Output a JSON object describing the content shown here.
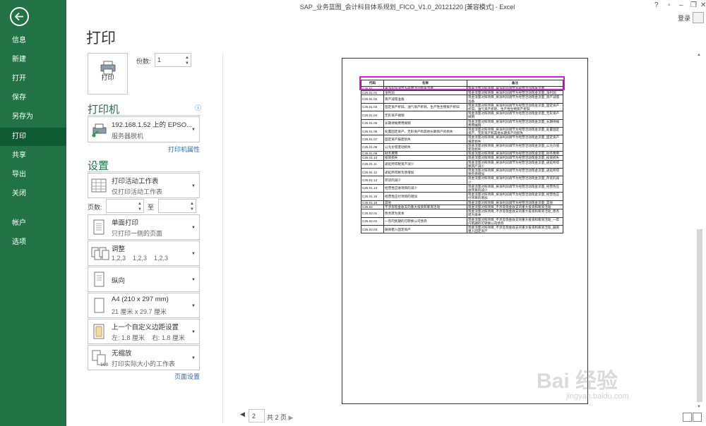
{
  "window": {
    "title": "SAP_业务蓝图_会计科目体系规划_FICO_V1.0_20121220  [兼容模式] - Excel",
    "help": "?",
    "login": "登录"
  },
  "nav": {
    "items": [
      "信息",
      "新建",
      "打开",
      "保存",
      "另存为",
      "打印",
      "共享",
      "导出",
      "关闭",
      "帐户",
      "选项"
    ],
    "active": "打印"
  },
  "print": {
    "heading": "打印",
    "print_button": "打印",
    "copies_label": "份数:",
    "copies_value": "1",
    "printer_section": "打印机",
    "printer_name": "192.168.1.52 上的 EPSO...",
    "printer_status": "服务器脱机",
    "printer_props": "打印机属性",
    "settings_section": "设置",
    "what_main": "打印活动工作表",
    "what_sub": "仅打印活动工作表",
    "pages_label": "页数:",
    "to_label": "至",
    "sides_main": "单面打印",
    "sides_sub": "只打印一侧的页面",
    "collate_main": "调整",
    "collate_sub": "1,2,3    1,2,3    1,2,3",
    "orientation": "纵向",
    "paper_main": "A4 (210 x 297 mm)",
    "paper_sub": "21 厘米 x 29.7 厘米",
    "margins_main": "上一个自定义边距设置",
    "margins_sub": "左: 1.8 厘米    右: 1.8 厘米",
    "scale_main": "无缩放",
    "scale_sub": "打印实际大小的工作表",
    "page_setup": "页面设置"
  },
  "preview": {
    "headers": [
      "代码",
      "名称",
      "备注"
    ],
    "rows": [
      [
        "C25.01",
        "将净利润调节为经营活动现金流量",
        "现金流量对照项目_将净利润调节为经营活动现金流量"
      ],
      [
        "C25.01.01",
        "净利润",
        "现金流量对照项目_将净利润调节为经营活动现金流量_净利润"
      ],
      [
        "C25.01.02",
        "资产减值准备",
        "现金流量对照项目_将净利润调节为经营活动现金流量_资产减值准备"
      ],
      [
        "C25.01.03",
        "固定资产折旧、油气资产折耗、生产性生物资产折旧",
        "现金流量对照项目_将净利润调节为经营活动现金流量_固定资产折旧、油气资产折耗、生产性生物资产折旧"
      ],
      [
        "C25.01.04",
        "无形资产摊销",
        "现金流量对照项目_将净利润调节为经营活动现金流量_无形资产摊销"
      ],
      [
        "C25.01.05",
        "长期待摊费用摊销",
        "现金流量对照项目_将净利润调节为经营活动现金流量_长期待摊费用摊销"
      ],
      [
        "C25.01.06",
        "处置固定资产、无形资产和其他长期资产的损失",
        "现金流量对照项目_将净利润调节为经营活动现金流量_处置固定资产、无形资产和其他长期资产的损失"
      ],
      [
        "C25.01.07",
        "固定资产报废损失",
        "现金流量对照项目_将净利润调节为经营活动现金流量_固定资产报废损失"
      ],
      [
        "C25.01.08",
        "公允价值变动损失",
        "现金流量对照项目_将净利润调节为经营活动现金流量_公允价值变动损失"
      ],
      [
        "C25.01.09",
        "财务费用",
        "现金流量对照项目_将净利润调节为经营活动现金流量_财务费用"
      ],
      [
        "C25.01.10",
        "投资损失",
        "现金流量对照项目_将净利润调节为经营活动现金流量_投资损失"
      ],
      [
        "C25.01.11",
        "递延所得税资产减少",
        "现金流量对照项目_将净利润调节为经营活动现金流量_递延所得税资产减少"
      ],
      [
        "C25.01.12",
        "递延所得税负债增加",
        "现金流量对照项目_将净利润调节为经营活动现金流量_递延所得税负债增加"
      ],
      [
        "C25.01.13",
        "存货的减少",
        "现金流量对照项目_将净利润调节为经营活动现金流量_存货的减少"
      ],
      [
        "C25.01.14",
        "经营性应收项目的减少",
        "现金流量对照项目_将净利润调节为经营活动现金流量_经营性应收项目的减少"
      ],
      [
        "C25.01.15",
        "经营性应付项目的增加",
        "现金流量对照项目_将净利润调节为经营活动现金流量_经营性应付项目的增加"
      ],
      [
        "C25.01.16",
        "其他",
        "现金流量对照项目_将净利润调节为经营活动现金流量_其他"
      ],
      [
        "C25.02",
        "不涉及现金收支的重大投资和筹资活动",
        "现金流量对照项目_不涉及现金收支的重大投资和筹资活动"
      ],
      [
        "C25.02.01",
        "债务转为资本",
        "现金流量对照项目_不涉及现金收支的重大投资和筹资活动_债务转为资本"
      ],
      [
        "C25.02.02",
        "一年内到期的可转换公司债券",
        "现金流量对照项目_不涉及现金收支的重大投资和筹资活动_一年内到期的可转换公司债券"
      ],
      [
        "C25.02.03",
        "融资租入固定资产",
        "现金流量对照项目_不涉及现金收支的重大投资和筹资活动_融资租入固定资产"
      ]
    ],
    "page_current": "2",
    "page_total": "共 2 页"
  },
  "watermark": {
    "text": "Bai 经验",
    "url": "jingyan.baidu.com"
  }
}
